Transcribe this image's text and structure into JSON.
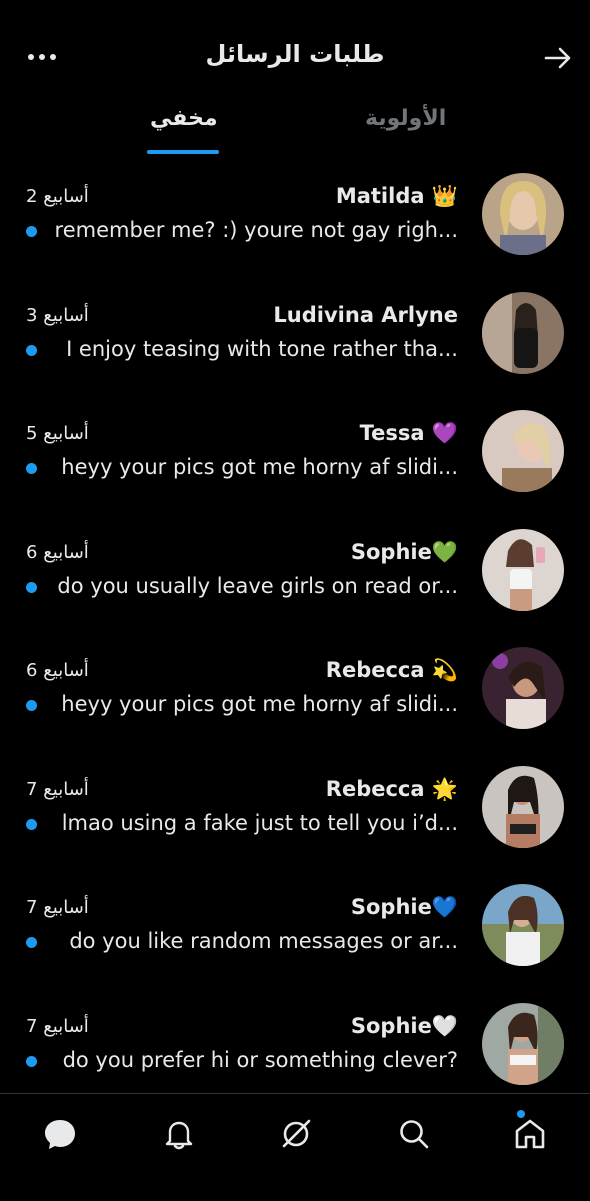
{
  "header": {
    "title": "طلبات الرسائل"
  },
  "tabs": [
    {
      "label": "مخفي",
      "active": true
    },
    {
      "label": "الأولوية",
      "active": false
    }
  ],
  "colors": {
    "accent": "#1d9bf0",
    "background": "#000000",
    "text": "#e7e9ea",
    "muted": "#71767b"
  },
  "messages": [
    {
      "name": "Matilda 👑",
      "time": "2 أسابيع",
      "preview": "remember me? :) youre not gay righ...",
      "unread": true
    },
    {
      "name": "Ludivina Arlyne",
      "time": "3 أسابيع",
      "preview": "I enjoy teasing with tone rather tha...",
      "unread": true
    },
    {
      "name": "Tessa 💜",
      "time": "5 أسابيع",
      "preview": "heyy your pics got me horny af slidi...",
      "unread": true
    },
    {
      "name": "Sophie💚",
      "time": "6 أسابيع",
      "preview": "do you usually leave girls on read or...",
      "unread": true
    },
    {
      "name": "Rebecca 💫",
      "time": "6 أسابيع",
      "preview": "heyy your pics got me horny af slidi...",
      "unread": true
    },
    {
      "name": "Rebecca 🌟",
      "time": "7 أسابيع",
      "preview": "lmao using a fake just to tell you i’d...",
      "unread": true
    },
    {
      "name": "Sophie💙",
      "time": "7 أسابيع",
      "preview": "do you like random messages or ar...",
      "unread": true
    },
    {
      "name": "Sophie🤍",
      "time": "7 أسابيع",
      "preview": "do you prefer hi or something clever?",
      "unread": true
    }
  ],
  "bottom_nav": [
    {
      "icon": "messages-icon"
    },
    {
      "icon": "notifications-icon"
    },
    {
      "icon": "grok-icon"
    },
    {
      "icon": "search-icon"
    },
    {
      "icon": "home-icon",
      "badge": true
    }
  ]
}
